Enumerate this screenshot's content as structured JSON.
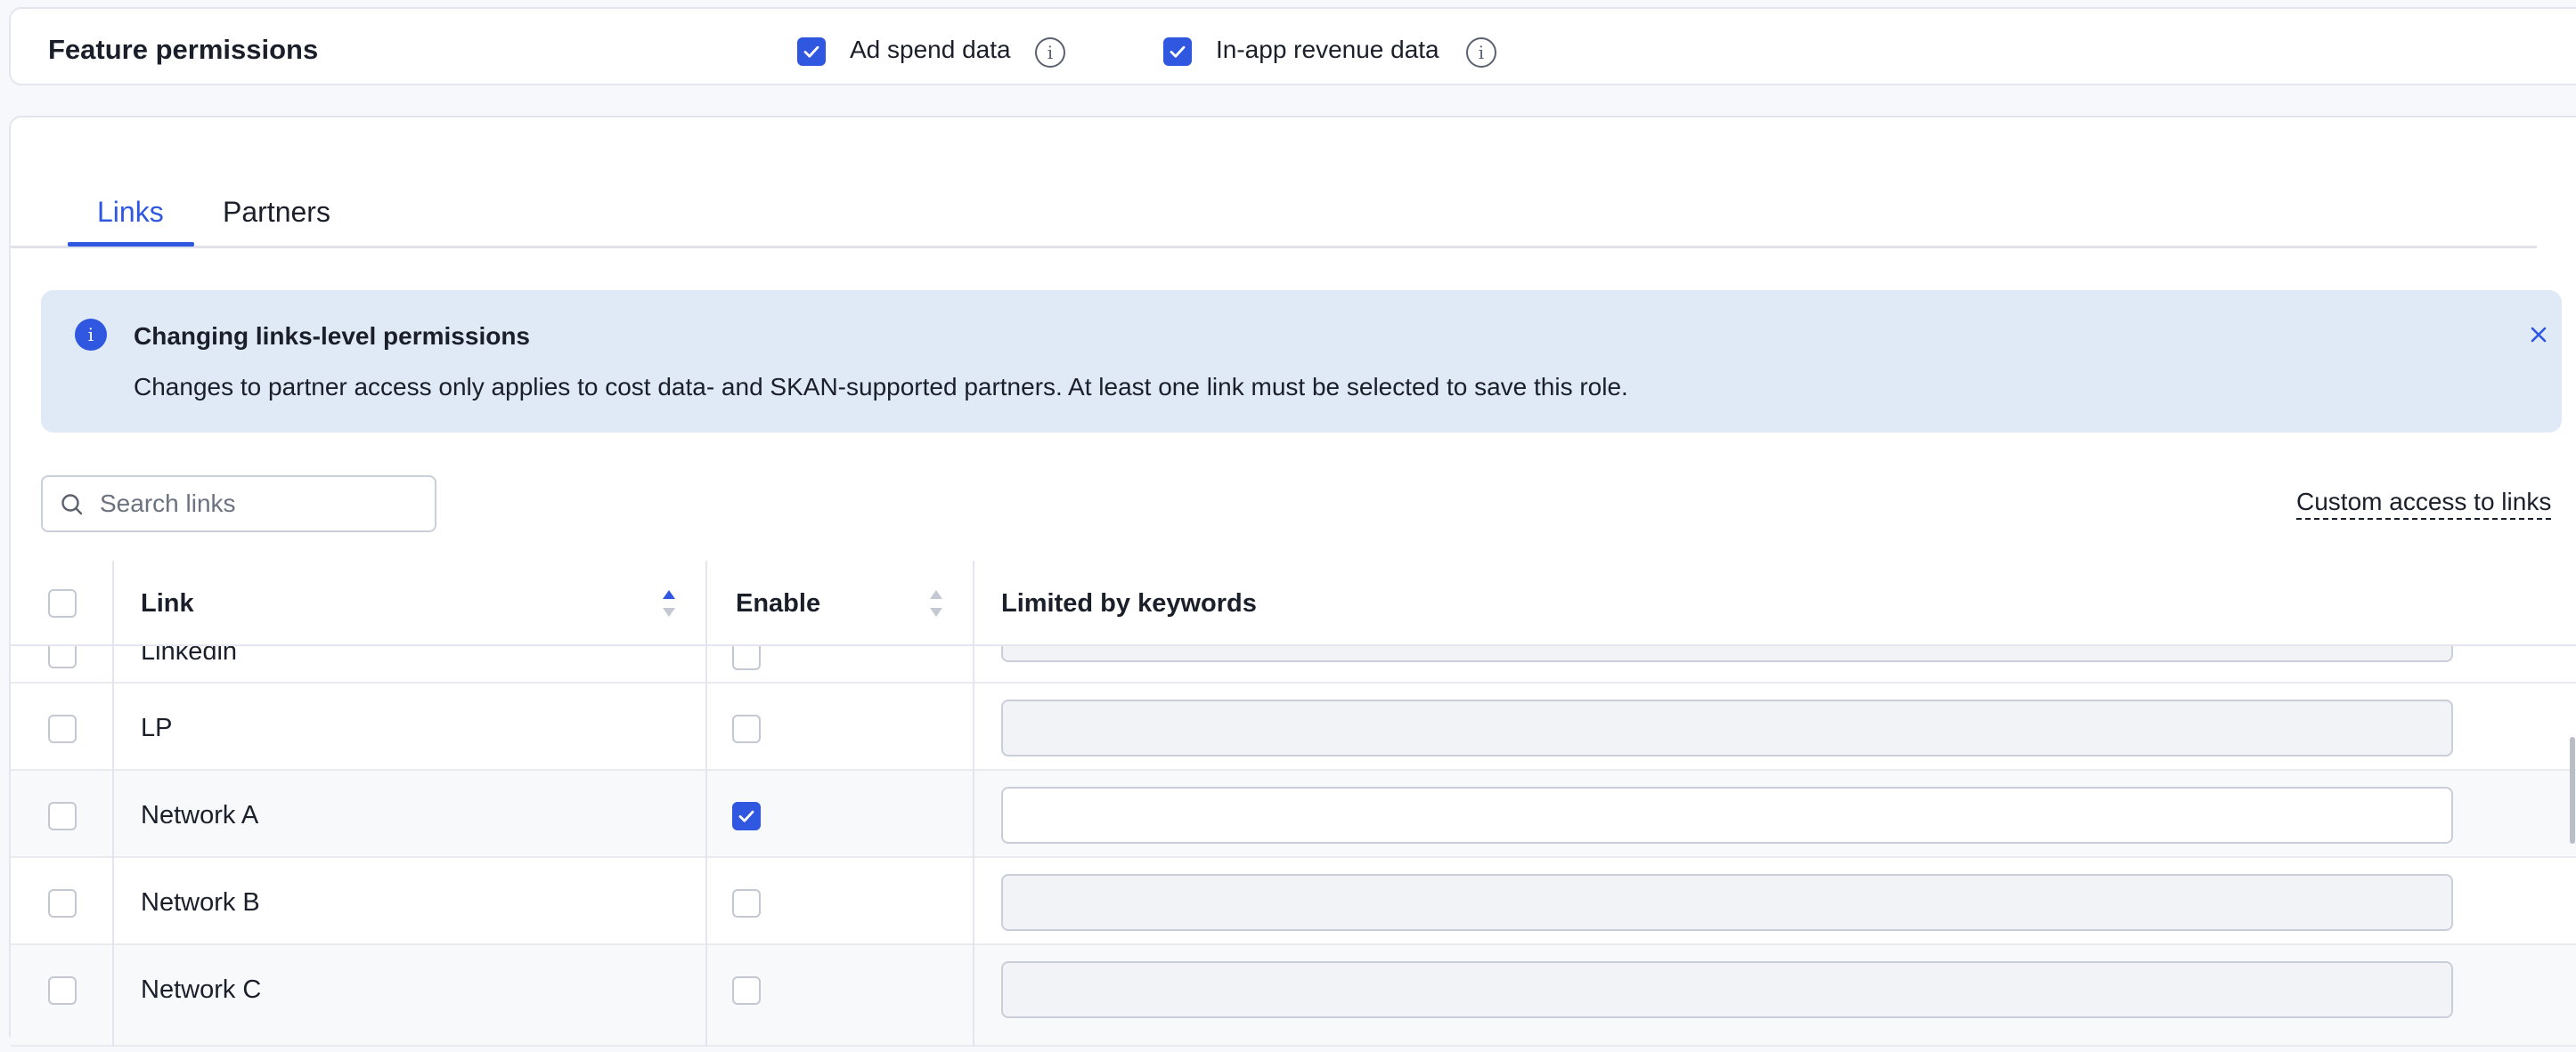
{
  "feature_permissions": {
    "title": "Feature permissions",
    "options": [
      {
        "label": "Ad spend data",
        "checked": true,
        "icon": "info-icon"
      },
      {
        "label": "In-app revenue data",
        "checked": true,
        "icon": "info-icon"
      }
    ]
  },
  "tabs": [
    {
      "label": "Links",
      "active": true
    },
    {
      "label": "Partners",
      "active": false
    }
  ],
  "alert": {
    "title": "Changing links-level permissions",
    "text": "Changes to partner access only applies to cost data- and SKAN-supported partners. At least one link must be selected to save this role.",
    "icon": "i"
  },
  "search": {
    "placeholder": "Search links",
    "value": ""
  },
  "custom_access_label": "Custom access to links",
  "table": {
    "columns": [
      "Link",
      "Enable",
      "Limited by keywords"
    ],
    "sort": {
      "column": "Link",
      "direction": "ascending"
    },
    "rows": [
      {
        "link": "Linkedin",
        "selected": false,
        "enabled": false,
        "keywords": ""
      },
      {
        "link": "LP",
        "selected": false,
        "enabled": false,
        "keywords": ""
      },
      {
        "link": "Network A",
        "selected": false,
        "enabled": true,
        "keywords": ""
      },
      {
        "link": "Network B",
        "selected": false,
        "enabled": false,
        "keywords": ""
      },
      {
        "link": "Network C",
        "selected": false,
        "enabled": false,
        "keywords": ""
      }
    ]
  },
  "colors": {
    "accent": "#2f57e0",
    "alert_bg": "#dfeaf6"
  }
}
